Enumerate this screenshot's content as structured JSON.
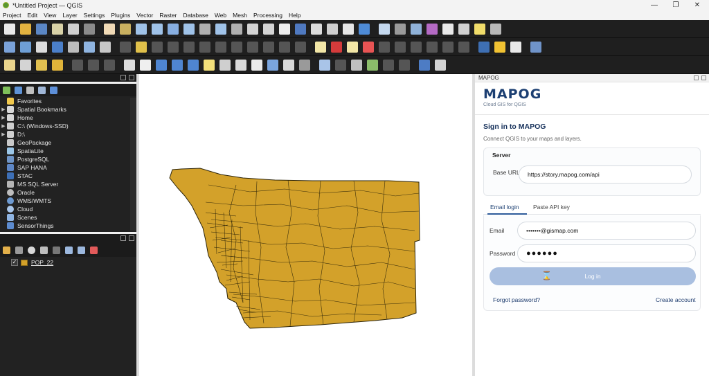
{
  "window": {
    "title": "*Untitled Project — QGIS",
    "controls": [
      "—",
      "❐",
      "✕"
    ]
  },
  "menu": [
    "Project",
    "Edit",
    "View",
    "Layer",
    "Settings",
    "Plugins",
    "Vector",
    "Raster",
    "Database",
    "Web",
    "Mesh",
    "Processing",
    "Help"
  ],
  "browser": {
    "items": [
      {
        "label": "Favorites",
        "icon": "star-icon",
        "expander": ""
      },
      {
        "label": "Spatial Bookmarks",
        "icon": "bookmark-icon",
        "expander": "▶"
      },
      {
        "label": "Home",
        "icon": "folder-icon",
        "expander": "▶"
      },
      {
        "label": "C:\\ (Windows-SSD)",
        "icon": "drive-icon",
        "expander": "▶"
      },
      {
        "label": "D:\\",
        "icon": "drive-icon",
        "expander": "▶"
      },
      {
        "label": "GeoPackage",
        "icon": "geopackage-icon",
        "expander": ""
      },
      {
        "label": "SpatiaLite",
        "icon": "spatialite-icon",
        "expander": ""
      },
      {
        "label": "PostgreSQL",
        "icon": "postgresql-icon",
        "expander": ""
      },
      {
        "label": "SAP HANA",
        "icon": "sap-hana-icon",
        "expander": ""
      },
      {
        "label": "STAC",
        "icon": "stac-icon",
        "expander": ""
      },
      {
        "label": "MS SQL Server",
        "icon": "mssql-icon",
        "expander": ""
      },
      {
        "label": "Oracle",
        "icon": "oracle-icon",
        "expander": ""
      },
      {
        "label": "WMS/WMTS",
        "icon": "wms-icon",
        "expander": ""
      },
      {
        "label": "Cloud",
        "icon": "cloud-icon",
        "expander": ""
      },
      {
        "label": "Scenes",
        "icon": "scenes-icon",
        "expander": ""
      },
      {
        "label": "SensorThings",
        "icon": "sensorthings-icon",
        "expander": ""
      }
    ]
  },
  "layers": {
    "items": [
      {
        "name": "POP_22",
        "checked": true,
        "checkmark": "✓",
        "fill_color": "#d3a12a"
      }
    ]
  },
  "plugin": {
    "panel_title": "MAPOG",
    "brand": "MAPOG",
    "tagline": "Cloud GIS for QGIS",
    "heading": "Sign in to MAPOG",
    "subheading": "Connect QGIS to your maps and layers.",
    "server_section": "Server",
    "base_url_label": "Base URL",
    "base_url_value": "https://story.mapog.com/api",
    "tabs": [
      "Email login",
      "Paste API key"
    ],
    "email_label": "Email",
    "email_value": "•••••••@gismap.com",
    "password_label": "Password",
    "password_value": "●●●●●●",
    "login_button": "Log in",
    "forgot_link": "Forgot password?",
    "create_link": "Create account",
    "busy_icon": "⌛"
  },
  "colors": {
    "map_fill": "#d3a12a",
    "map_outline": "#2a2208",
    "accent": "#1c3f72",
    "button": "#a9bfe0"
  }
}
